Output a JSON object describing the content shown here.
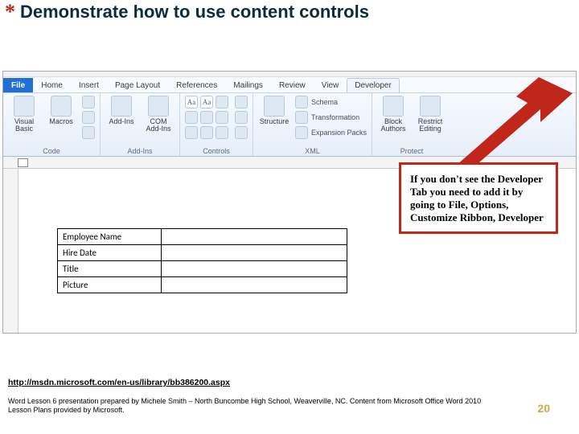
{
  "title": "Demonstrate how to use content controls",
  "asterisk": "*",
  "tabs": {
    "file": "File",
    "home": "Home",
    "insert": "Insert",
    "pagelayout": "Page Layout",
    "references": "References",
    "mailings": "Mailings",
    "review": "Review",
    "view": "View",
    "developer": "Developer"
  },
  "groups": {
    "code": {
      "label": "Code",
      "visualbasic": "Visual Basic",
      "macros": "Macros"
    },
    "addins": {
      "label": "Add-Ins",
      "addins": "Add-Ins",
      "com": "COM Add-Ins"
    },
    "controls": {
      "label": "Controls",
      "aa1": "Aa",
      "aa2": "Aa"
    },
    "xml": {
      "label": "XML",
      "structure": "Structure",
      "schema": "Schema",
      "transformation": "Transformation",
      "expansion": "Expansion Packs"
    },
    "protect": {
      "label": "Protect",
      "block": "Block Authors",
      "restrict": "Restrict Editing"
    }
  },
  "form": {
    "r1": "Employee Name",
    "r2": "Hire Date",
    "r3": "Title",
    "r4": "Picture"
  },
  "callout": "If you don't see the Developer Tab you need to add it by going to File, Options, Customize Ribbon, Developer",
  "link": "http://msdn.microsoft.com/en-us/library/bb386200.aspx",
  "credit": "Word Lesson 6 presentation prepared by Michele Smith – North Buncombe High School, Weaverville, NC. Content from Microsoft Office Word 2010 Lesson Plans provided by Microsoft.",
  "pagenum": "20"
}
